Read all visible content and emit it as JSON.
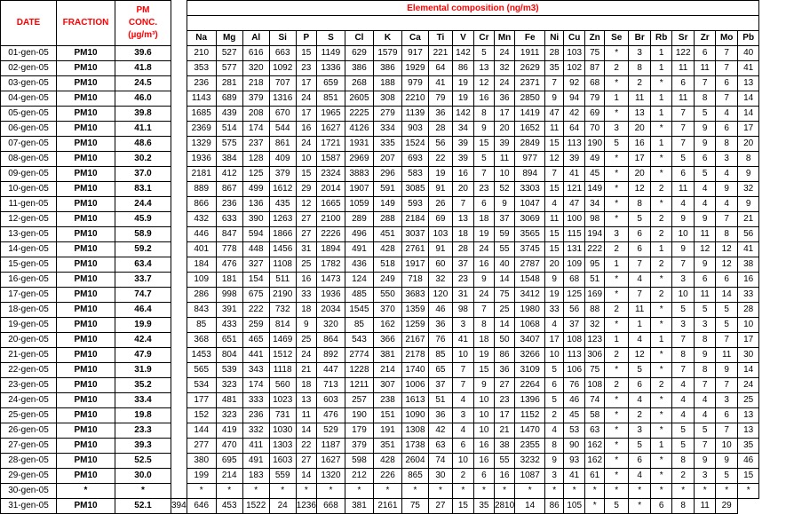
{
  "headers": {
    "date": "DATE",
    "fraction": "FRACTION",
    "pm_line1": "PM",
    "pm_line2": "CONC.",
    "pm_line3": "(µg/m³)",
    "elemental_title": "Elemental composition (ng/m3)"
  },
  "elements": [
    "Na",
    "Mg",
    "Al",
    "Si",
    "P",
    "S",
    "Cl",
    "K",
    "Ca",
    "Ti",
    "V",
    "Cr",
    "Mn",
    "Fe",
    "Ni",
    "Cu",
    "Zn",
    "Se",
    "Br",
    "Rb",
    "Sr",
    "Zr",
    "Mo",
    "Pb"
  ],
  "rows": [
    {
      "date": "01-gen-05",
      "fraction": "PM10",
      "conc": "39.6",
      "values": [
        "210",
        "527",
        "616",
        "663",
        "15",
        "1149",
        "629",
        "1579",
        "917",
        "221",
        "142",
        "5",
        "24",
        "1911",
        "28",
        "103",
        "75",
        "*",
        "3",
        "1",
        "122",
        "6",
        "7",
        "40"
      ]
    },
    {
      "date": "02-gen-05",
      "fraction": "PM10",
      "conc": "41.8",
      "values": [
        "353",
        "577",
        "320",
        "1092",
        "23",
        "1336",
        "386",
        "386",
        "1929",
        "64",
        "86",
        "13",
        "32",
        "2629",
        "35",
        "102",
        "87",
        "2",
        "8",
        "1",
        "11",
        "11",
        "7",
        "41"
      ]
    },
    {
      "date": "03-gen-05",
      "fraction": "PM10",
      "conc": "24.5",
      "values": [
        "236",
        "281",
        "218",
        "707",
        "17",
        "659",
        "268",
        "188",
        "979",
        "41",
        "19",
        "12",
        "24",
        "2371",
        "7",
        "92",
        "68",
        "*",
        "2",
        "*",
        "6",
        "7",
        "6",
        "13"
      ]
    },
    {
      "date": "04-gen-05",
      "fraction": "PM10",
      "conc": "46.0",
      "values": [
        "1143",
        "689",
        "379",
        "1316",
        "24",
        "851",
        "2605",
        "308",
        "2210",
        "79",
        "19",
        "16",
        "36",
        "2850",
        "9",
        "94",
        "79",
        "1",
        "11",
        "1",
        "11",
        "8",
        "7",
        "14"
      ]
    },
    {
      "date": "05-gen-05",
      "fraction": "PM10",
      "conc": "39.8",
      "values": [
        "1685",
        "439",
        "208",
        "670",
        "17",
        "1965",
        "2225",
        "279",
        "1139",
        "36",
        "142",
        "8",
        "17",
        "1419",
        "47",
        "42",
        "69",
        "*",
        "13",
        "1",
        "7",
        "5",
        "4",
        "14"
      ]
    },
    {
      "date": "06-gen-05",
      "fraction": "PM10",
      "conc": "41.1",
      "values": [
        "2369",
        "514",
        "174",
        "544",
        "16",
        "1627",
        "4126",
        "334",
        "903",
        "28",
        "34",
        "9",
        "20",
        "1652",
        "11",
        "64",
        "70",
        "3",
        "20",
        "*",
        "7",
        "9",
        "6",
        "17"
      ]
    },
    {
      "date": "07-gen-05",
      "fraction": "PM10",
      "conc": "48.6",
      "values": [
        "1329",
        "575",
        "237",
        "861",
        "24",
        "1721",
        "1931",
        "335",
        "1524",
        "56",
        "39",
        "15",
        "39",
        "2849",
        "15",
        "113",
        "190",
        "5",
        "16",
        "1",
        "7",
        "9",
        "8",
        "20"
      ]
    },
    {
      "date": "08-gen-05",
      "fraction": "PM10",
      "conc": "30.2",
      "values": [
        "1936",
        "384",
        "128",
        "409",
        "10",
        "1587",
        "2969",
        "207",
        "693",
        "22",
        "39",
        "5",
        "11",
        "977",
        "12",
        "39",
        "49",
        "*",
        "17",
        "*",
        "5",
        "6",
        "3",
        "8"
      ]
    },
    {
      "date": "09-gen-05",
      "fraction": "PM10",
      "conc": "37.0",
      "values": [
        "2181",
        "412",
        "125",
        "379",
        "15",
        "2324",
        "3883",
        "296",
        "583",
        "19",
        "16",
        "7",
        "10",
        "894",
        "7",
        "41",
        "45",
        "*",
        "20",
        "*",
        "6",
        "5",
        "4",
        "9"
      ]
    },
    {
      "date": "10-gen-05",
      "fraction": "PM10",
      "conc": "83.1",
      "values": [
        "889",
        "867",
        "499",
        "1612",
        "29",
        "2014",
        "1907",
        "591",
        "3085",
        "91",
        "20",
        "23",
        "52",
        "3303",
        "15",
        "121",
        "149",
        "*",
        "12",
        "2",
        "11",
        "4",
        "9",
        "32"
      ]
    },
    {
      "date": "11-gen-05",
      "fraction": "PM10",
      "conc": "24.4",
      "values": [
        "866",
        "236",
        "136",
        "435",
        "12",
        "1665",
        "1059",
        "149",
        "593",
        "26",
        "7",
        "6",
        "9",
        "1047",
        "4",
        "47",
        "34",
        "*",
        "8",
        "*",
        "4",
        "4",
        "4",
        "9"
      ]
    },
    {
      "date": "12-gen-05",
      "fraction": "PM10",
      "conc": "45.9",
      "values": [
        "432",
        "633",
        "390",
        "1263",
        "27",
        "2100",
        "289",
        "288",
        "2184",
        "69",
        "13",
        "18",
        "37",
        "3069",
        "11",
        "100",
        "98",
        "*",
        "5",
        "2",
        "9",
        "9",
        "7",
        "21"
      ]
    },
    {
      "date": "13-gen-05",
      "fraction": "PM10",
      "conc": "58.9",
      "values": [
        "446",
        "847",
        "594",
        "1866",
        "27",
        "2226",
        "496",
        "451",
        "3037",
        "103",
        "18",
        "19",
        "59",
        "3565",
        "15",
        "115",
        "194",
        "3",
        "6",
        "2",
        "10",
        "11",
        "8",
        "56"
      ]
    },
    {
      "date": "14-gen-05",
      "fraction": "PM10",
      "conc": "59.2",
      "values": [
        "401",
        "778",
        "448",
        "1456",
        "31",
        "1894",
        "491",
        "428",
        "2761",
        "91",
        "28",
        "24",
        "55",
        "3745",
        "15",
        "131",
        "222",
        "2",
        "6",
        "1",
        "9",
        "12",
        "12",
        "41"
      ]
    },
    {
      "date": "15-gen-05",
      "fraction": "PM10",
      "conc": "63.4",
      "values": [
        "184",
        "476",
        "327",
        "1108",
        "25",
        "1782",
        "436",
        "518",
        "1917",
        "60",
        "37",
        "16",
        "40",
        "2787",
        "20",
        "109",
        "95",
        "1",
        "7",
        "2",
        "7",
        "9",
        "12",
        "38"
      ]
    },
    {
      "date": "16-gen-05",
      "fraction": "PM10",
      "conc": "33.7",
      "values": [
        "109",
        "181",
        "154",
        "511",
        "16",
        "1473",
        "124",
        "249",
        "718",
        "32",
        "23",
        "9",
        "14",
        "1548",
        "9",
        "68",
        "51",
        "*",
        "4",
        "*",
        "3",
        "6",
        "6",
        "16"
      ]
    },
    {
      "date": "17-gen-05",
      "fraction": "PM10",
      "conc": "74.7",
      "values": [
        "286",
        "998",
        "675",
        "2190",
        "33",
        "1936",
        "485",
        "550",
        "3683",
        "120",
        "31",
        "24",
        "75",
        "3412",
        "19",
        "125",
        "169",
        "*",
        "7",
        "2",
        "10",
        "11",
        "14",
        "33"
      ]
    },
    {
      "date": "18-gen-05",
      "fraction": "PM10",
      "conc": "46.4",
      "values": [
        "843",
        "391",
        "222",
        "732",
        "18",
        "2034",
        "1545",
        "370",
        "1359",
        "46",
        "98",
        "7",
        "25",
        "1980",
        "33",
        "56",
        "88",
        "2",
        "11",
        "*",
        "5",
        "5",
        "5",
        "28"
      ]
    },
    {
      "date": "19-gen-05",
      "fraction": "PM10",
      "conc": "19.9",
      "values": [
        "85",
        "433",
        "259",
        "814",
        "9",
        "320",
        "85",
        "162",
        "1259",
        "36",
        "3",
        "8",
        "14",
        "1068",
        "4",
        "37",
        "32",
        "*",
        "1",
        "*",
        "3",
        "3",
        "5",
        "10"
      ]
    },
    {
      "date": "20-gen-05",
      "fraction": "PM10",
      "conc": "42.4",
      "values": [
        "368",
        "651",
        "465",
        "1469",
        "25",
        "864",
        "543",
        "366",
        "2167",
        "76",
        "41",
        "18",
        "50",
        "3407",
        "17",
        "108",
        "123",
        "1",
        "4",
        "1",
        "7",
        "8",
        "7",
        "17"
      ]
    },
    {
      "date": "21-gen-05",
      "fraction": "PM10",
      "conc": "47.9",
      "values": [
        "1453",
        "804",
        "441",
        "1512",
        "24",
        "892",
        "2774",
        "381",
        "2178",
        "85",
        "10",
        "19",
        "86",
        "3266",
        "10",
        "113",
        "306",
        "2",
        "12",
        "*",
        "8",
        "9",
        "11",
        "30"
      ]
    },
    {
      "date": "22-gen-05",
      "fraction": "PM10",
      "conc": "31.9",
      "values": [
        "565",
        "539",
        "343",
        "1118",
        "21",
        "447",
        "1228",
        "214",
        "1740",
        "65",
        "7",
        "15",
        "36",
        "3109",
        "5",
        "106",
        "75",
        "*",
        "5",
        "*",
        "7",
        "8",
        "9",
        "14"
      ]
    },
    {
      "date": "23-gen-05",
      "fraction": "PM10",
      "conc": "35.2",
      "values": [
        "534",
        "323",
        "174",
        "560",
        "18",
        "713",
        "1211",
        "307",
        "1006",
        "37",
        "7",
        "9",
        "27",
        "2264",
        "6",
        "76",
        "108",
        "2",
        "6",
        "2",
        "4",
        "7",
        "7",
        "24"
      ]
    },
    {
      "date": "24-gen-05",
      "fraction": "PM10",
      "conc": "33.4",
      "values": [
        "177",
        "481",
        "333",
        "1023",
        "13",
        "603",
        "257",
        "238",
        "1613",
        "51",
        "4",
        "10",
        "23",
        "1396",
        "5",
        "46",
        "74",
        "*",
        "4",
        "*",
        "4",
        "4",
        "3",
        "25"
      ]
    },
    {
      "date": "25-gen-05",
      "fraction": "PM10",
      "conc": "19.8",
      "values": [
        "152",
        "323",
        "236",
        "731",
        "11",
        "476",
        "190",
        "151",
        "1090",
        "36",
        "3",
        "10",
        "17",
        "1152",
        "2",
        "45",
        "58",
        "*",
        "2",
        "*",
        "4",
        "4",
        "6",
        "13"
      ]
    },
    {
      "date": "26-gen-05",
      "fraction": "PM10",
      "conc": "23.3",
      "values": [
        "144",
        "419",
        "332",
        "1030",
        "14",
        "529",
        "179",
        "191",
        "1308",
        "42",
        "4",
        "10",
        "21",
        "1470",
        "4",
        "53",
        "63",
        "*",
        "3",
        "*",
        "5",
        "5",
        "7",
        "13"
      ]
    },
    {
      "date": "27-gen-05",
      "fraction": "PM10",
      "conc": "39.3",
      "values": [
        "277",
        "470",
        "411",
        "1303",
        "22",
        "1187",
        "379",
        "351",
        "1738",
        "63",
        "6",
        "16",
        "38",
        "2355",
        "8",
        "90",
        "162",
        "*",
        "5",
        "1",
        "5",
        "7",
        "10",
        "35"
      ]
    },
    {
      "date": "28-gen-05",
      "fraction": "PM10",
      "conc": "52.5",
      "values": [
        "380",
        "695",
        "491",
        "1603",
        "27",
        "1627",
        "598",
        "428",
        "2604",
        "74",
        "10",
        "16",
        "55",
        "3232",
        "9",
        "93",
        "162",
        "*",
        "6",
        "*",
        "8",
        "9",
        "9",
        "46"
      ]
    },
    {
      "date": "29-gen-05",
      "fraction": "PM10",
      "conc": "30.0",
      "values": [
        "199",
        "214",
        "183",
        "559",
        "14",
        "1320",
        "212",
        "226",
        "865",
        "30",
        "2",
        "6",
        "16",
        "1087",
        "3",
        "41",
        "61",
        "*",
        "4",
        "*",
        "2",
        "3",
        "5",
        "15"
      ]
    },
    {
      "date": "30-gen-05",
      "fraction": "*",
      "conc": "*",
      "values": [
        "*",
        "*",
        "*",
        "*",
        "*",
        "*",
        "*",
        "*",
        "*",
        "*",
        "*",
        "*",
        "*",
        "*",
        "*",
        "*",
        "*",
        "*",
        "*",
        "*",
        "*",
        "*",
        "*",
        "*"
      ]
    },
    {
      "date": "31-gen-05",
      "fraction": "PM10",
      "conc": "52.1",
      "values": [
        "394",
        "646",
        "453",
        "1522",
        "24",
        "1236",
        "668",
        "381",
        "2161",
        "75",
        "27",
        "15",
        "35",
        "2810",
        "14",
        "86",
        "105",
        "*",
        "5",
        "*",
        "6",
        "8",
        "11",
        "29"
      ]
    }
  ]
}
